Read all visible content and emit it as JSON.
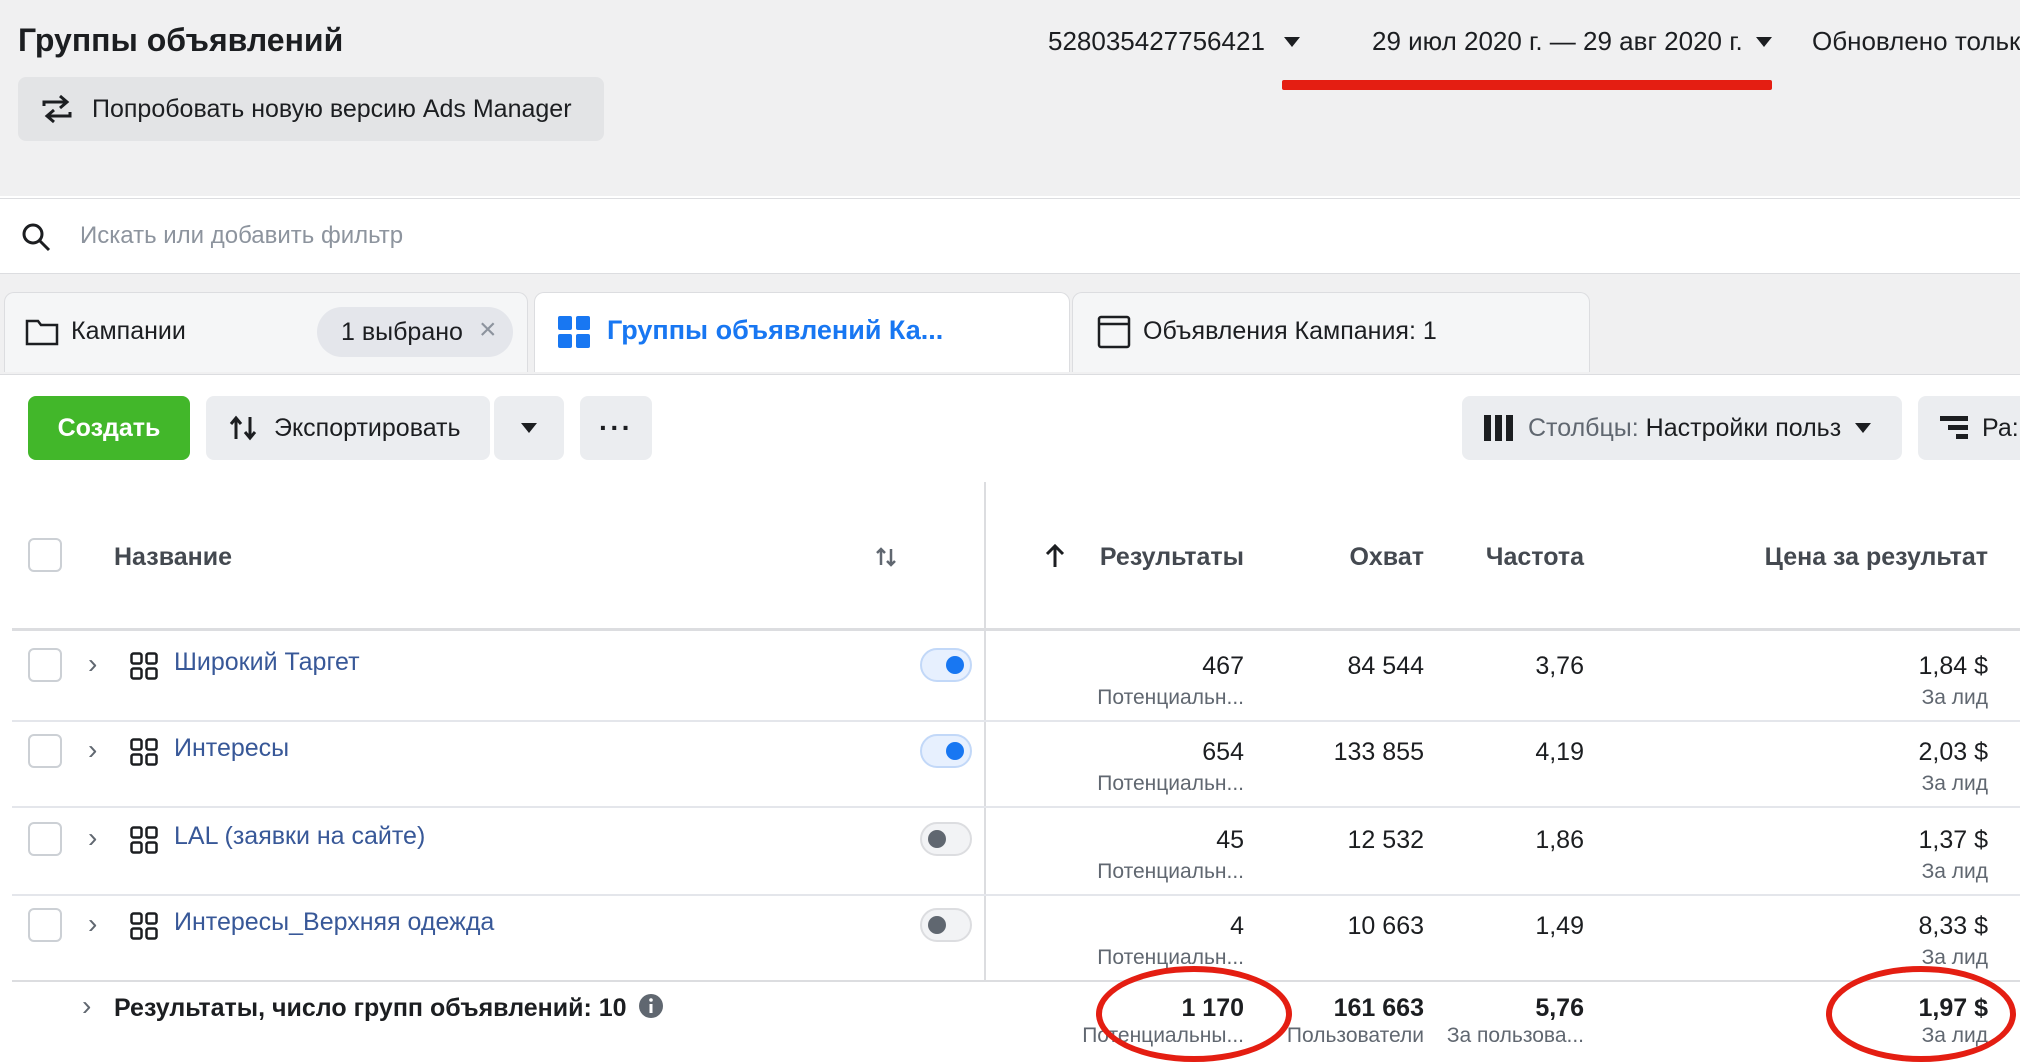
{
  "header": {
    "title": "Группы объявлений",
    "account_id": "528035427756421",
    "date_range": "29 июл 2020 г. — 29 авг 2020 г.",
    "updated": "Обновлено тольк",
    "try_new_version": "Попробовать новую версию Ads Manager"
  },
  "search": {
    "placeholder": "Искать или добавить фильтр"
  },
  "tabs": [
    {
      "label": "Кампании",
      "badge": "1 выбрано"
    },
    {
      "label": "Группы объявлений Ка..."
    },
    {
      "label": "Объявления Кампания: 1"
    }
  ],
  "toolbar": {
    "create": "Создать",
    "export": "Экспортировать",
    "more": "···",
    "columns_label": "Столбцы:",
    "columns_value": "Настройки польз",
    "breakdown": "Ра:"
  },
  "table": {
    "columns": {
      "name": "Название",
      "results": "Результаты",
      "reach": "Охват",
      "frequency": "Частота",
      "cost": "Цена за результат"
    },
    "rows": [
      {
        "name": "Широкий Таргет",
        "active": true,
        "results": "467",
        "results_sub": "Потенциальн...",
        "reach": "84 544",
        "frequency": "3,76",
        "cost": "1,84 $",
        "cost_sub": "За лид"
      },
      {
        "name": "Интересы",
        "active": true,
        "results": "654",
        "results_sub": "Потенциальн...",
        "reach": "133 855",
        "frequency": "4,19",
        "cost": "2,03 $",
        "cost_sub": "За лид"
      },
      {
        "name": "LAL (заявки на сайте)",
        "active": false,
        "results": "45",
        "results_sub": "Потенциальн...",
        "reach": "12 532",
        "frequency": "1,86",
        "cost": "1,37 $",
        "cost_sub": "За лид"
      },
      {
        "name": "Интересы_Верхняя одежда",
        "active": false,
        "results": "4",
        "results_sub": "Потенциальн...",
        "reach": "10 663",
        "frequency": "1,49",
        "cost": "8,33 $",
        "cost_sub": "За лид"
      }
    ],
    "summary": {
      "label": "Результаты, число групп объявлений: 10",
      "results": "1 170",
      "results_sub": "Потенциальны...",
      "reach": "161 663",
      "reach_sub": "Пользователи",
      "frequency": "5,76",
      "frequency_sub": "За пользова...",
      "cost": "1,97 $",
      "cost_sub": "За лид"
    }
  },
  "colors": {
    "accent": "#1877f2",
    "create_green": "#42b72a",
    "link": "#385898",
    "annotation_red": "#e41e12"
  }
}
